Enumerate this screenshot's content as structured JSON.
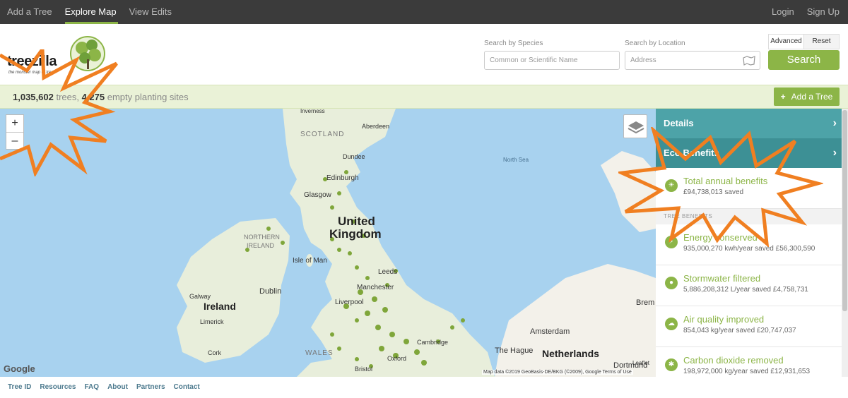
{
  "topnav": {
    "left": [
      "Add a Tree",
      "Explore Map",
      "View Edits"
    ],
    "right": [
      "Login",
      "Sign Up"
    ]
  },
  "logo": {
    "word": "treezilla",
    "tagline": "the monster map of trees"
  },
  "search": {
    "species_label": "Search by Species",
    "species_placeholder": "Common or Scientific Name",
    "location_label": "Search by Location",
    "location_placeholder": "Address",
    "advanced": "Advanced",
    "reset": "Reset",
    "button": "Search"
  },
  "counts": {
    "trees": "1,035,602",
    "trees_word": " trees, ",
    "sites": "4,275",
    "sites_word": " empty planting sites"
  },
  "add_tree": "Add a Tree",
  "map": {
    "labels": {
      "inverness": "Inverness",
      "aberdeen": "Aberdeen",
      "scotland": "SCOTLAND",
      "dundee": "Dundee",
      "edinburgh": "Edinburgh",
      "glasgow": "Glasgow",
      "north_sea": "North Sea",
      "united": "United",
      "kingdom": "Kingdom",
      "northern": "NORTHERN",
      "ireland_ni": "IRELAND",
      "isle_of_man": "Isle of Man",
      "leeds": "Leeds",
      "manchester": "Manchester",
      "liverpool": "Liverpool",
      "dublin": "Dublin",
      "ireland": "Ireland",
      "galway": "Galway",
      "limerick": "Limerick",
      "cork": "Cork",
      "wales": "WALES",
      "bristol": "Bristol",
      "oxford": "Oxford",
      "cambridge": "Cambridge",
      "amsterdam": "Amsterdam",
      "the_hague": "The Hague",
      "netherlands": "Netherlands",
      "dortmund": "Dortmund",
      "brem": "Brem"
    },
    "attribution": "Map data ©2019 GeoBasis-DE/BKG (©2009), Google   Terms of Use",
    "leaflet": "Leaflet",
    "google": "Google",
    "zoom_in": "+",
    "zoom_out": "–"
  },
  "panel": {
    "details": "Details",
    "eco": "Eco Benefits",
    "total": {
      "title": "Total annual benefits",
      "value": "£94,738,013 saved"
    },
    "section": "TREE BENEFITS",
    "items": [
      {
        "title": "Energy conserved",
        "value": "935,000,270 kwh/year saved £56,300,590",
        "icon": "bolt-icon"
      },
      {
        "title": "Stormwater filtered",
        "value": "5,886,208,312 L/year saved £4,758,731",
        "icon": "drop-icon"
      },
      {
        "title": "Air quality improved",
        "value": "854,043 kg/year saved £20,747,037",
        "icon": "cloud-icon"
      },
      {
        "title": "Carbon dioxide removed",
        "value": "198,972,000 kg/year saved £12,931,653",
        "icon": "co2-icon"
      }
    ]
  },
  "footer": [
    "Tree ID",
    "Resources",
    "FAQ",
    "About",
    "Partners",
    "Contact"
  ],
  "colors": {
    "green": "#8cb547",
    "teal": "#4da3a8",
    "orange": "#f07f21",
    "sea": "#a8d2ef",
    "land": "#f3f1ea"
  }
}
